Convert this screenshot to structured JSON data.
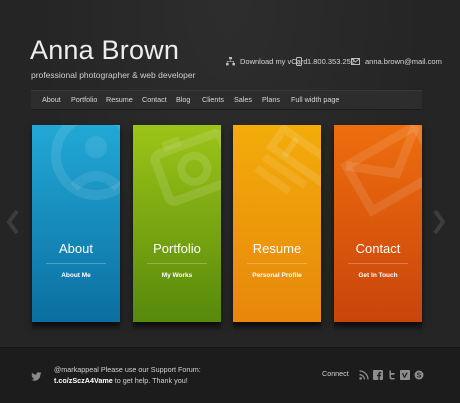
{
  "header": {
    "name": "Anna Brown",
    "tagline": "professional photographer & web developer",
    "contacts": [
      {
        "icon": "sitemap-icon",
        "label": "Download my vCard"
      },
      {
        "icon": "phone-icon",
        "label": "1.800.353.252"
      },
      {
        "icon": "mail-icon",
        "label": "anna.brown@mail.com"
      }
    ]
  },
  "nav": {
    "items": [
      {
        "label": "About"
      },
      {
        "label": "Portfolio"
      },
      {
        "label": "Resume"
      },
      {
        "label": "Contact"
      },
      {
        "label": "Blog"
      },
      {
        "label": "Clients"
      },
      {
        "label": "Sales"
      },
      {
        "label": "Plans"
      },
      {
        "label": "Full width page"
      }
    ]
  },
  "slider": {
    "prev_icon": "chevron-left-icon",
    "next_icon": "chevron-right-icon",
    "cards": [
      {
        "title": "About",
        "subtitle": "About Me",
        "color_top": "#22a8d6",
        "color_bottom": "#0b6fa0",
        "icon": "user-icon"
      },
      {
        "title": "Portfolio",
        "subtitle": "My Works",
        "color_top": "#9cc418",
        "color_bottom": "#57890b",
        "icon": "camera-icon"
      },
      {
        "title": "Resume",
        "subtitle": "Personal Profile",
        "color_top": "#f3ac0a",
        "color_bottom": "#e7870b",
        "icon": "pencil-icon"
      },
      {
        "title": "Contact",
        "subtitle": "Get In Touch",
        "color_top": "#ee6e0d",
        "color_bottom": "#c9440c",
        "icon": "mail-icon"
      }
    ]
  },
  "footer": {
    "twitter_icon": "twitter-bird-icon",
    "tweet_text": "@markappeal Please use our Support Forum: ",
    "tweet_link": "t.co/zSczA4Vame",
    "tweet_text_end": " to get help. Thank you!",
    "connect_label": "Connect",
    "social_icons": [
      "rss-icon",
      "facebook-icon",
      "twitter-icon",
      "vimeo-icon",
      "skype-icon"
    ]
  }
}
